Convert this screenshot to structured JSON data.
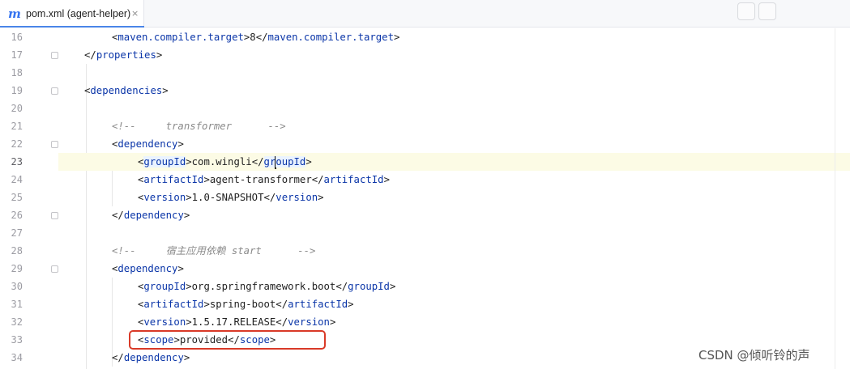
{
  "tab": {
    "title": "pom.xml (agent-helper)",
    "icon": "maven-icon",
    "close": "×"
  },
  "colors": {
    "tag": "#0a35a8",
    "comment": "#8b8b8b",
    "current_line": "#fcfbe5",
    "annotation_box": "#d93a28"
  },
  "lines": [
    {
      "num": "16",
      "parts": [
        {
          "t": "<",
          "c": "br"
        },
        {
          "t": "maven.compiler.target",
          "c": "tag"
        },
        {
          "t": ">",
          "c": "br"
        },
        {
          "t": "8",
          "c": "txt"
        },
        {
          "t": "</",
          "c": "br"
        },
        {
          "t": "maven.compiler.target",
          "c": "tag"
        },
        {
          "t": ">",
          "c": "br"
        }
      ]
    },
    {
      "num": "17",
      "parts": [
        {
          "t": "</",
          "c": "br"
        },
        {
          "t": "properties",
          "c": "tag"
        },
        {
          "t": ">",
          "c": "br"
        }
      ]
    },
    {
      "num": "18",
      "parts": []
    },
    {
      "num": "19",
      "parts": [
        {
          "t": "<",
          "c": "br"
        },
        {
          "t": "dependencies",
          "c": "tag"
        },
        {
          "t": ">",
          "c": "br"
        }
      ]
    },
    {
      "num": "20",
      "parts": []
    },
    {
      "num": "21",
      "parts": [
        {
          "t": "<!--     transformer      -->",
          "c": "cmt"
        }
      ]
    },
    {
      "num": "22",
      "parts": [
        {
          "t": "<",
          "c": "br"
        },
        {
          "t": "dependency",
          "c": "tag"
        },
        {
          "t": ">",
          "c": "br"
        }
      ]
    },
    {
      "num": "23",
      "parts": [
        {
          "t": "<",
          "c": "br"
        },
        {
          "t": "groupId",
          "c": "tag hl"
        },
        {
          "t": ">",
          "c": "br"
        },
        {
          "t": "com.wingli",
          "c": "txt"
        },
        {
          "t": "</",
          "c": "br"
        },
        {
          "t": "gr",
          "c": "tag hl"
        },
        {
          "t": "",
          "c": "caret"
        },
        {
          "t": "oupId",
          "c": "tag hl"
        },
        {
          "t": ">",
          "c": "br"
        }
      ]
    },
    {
      "num": "24",
      "parts": [
        {
          "t": "<",
          "c": "br"
        },
        {
          "t": "artifactId",
          "c": "tag"
        },
        {
          "t": ">",
          "c": "br"
        },
        {
          "t": "agent-transformer",
          "c": "txt"
        },
        {
          "t": "</",
          "c": "br"
        },
        {
          "t": "artifactId",
          "c": "tag"
        },
        {
          "t": ">",
          "c": "br"
        }
      ]
    },
    {
      "num": "25",
      "parts": [
        {
          "t": "<",
          "c": "br"
        },
        {
          "t": "version",
          "c": "tag"
        },
        {
          "t": ">",
          "c": "br"
        },
        {
          "t": "1.0-SNAPSHOT",
          "c": "txt"
        },
        {
          "t": "</",
          "c": "br"
        },
        {
          "t": "version",
          "c": "tag"
        },
        {
          "t": ">",
          "c": "br"
        }
      ]
    },
    {
      "num": "26",
      "parts": [
        {
          "t": "</",
          "c": "br"
        },
        {
          "t": "dependency",
          "c": "tag"
        },
        {
          "t": ">",
          "c": "br"
        }
      ]
    },
    {
      "num": "27",
      "parts": []
    },
    {
      "num": "28",
      "parts": [
        {
          "t": "<!--     宿主应用依赖 start      -->",
          "c": "cmt"
        }
      ]
    },
    {
      "num": "29",
      "parts": [
        {
          "t": "<",
          "c": "br"
        },
        {
          "t": "dependency",
          "c": "tag"
        },
        {
          "t": ">",
          "c": "br"
        }
      ]
    },
    {
      "num": "30",
      "parts": [
        {
          "t": "<",
          "c": "br"
        },
        {
          "t": "groupId",
          "c": "tag"
        },
        {
          "t": ">",
          "c": "br"
        },
        {
          "t": "org.springframework.boot",
          "c": "txt"
        },
        {
          "t": "</",
          "c": "br"
        },
        {
          "t": "groupId",
          "c": "tag"
        },
        {
          "t": ">",
          "c": "br"
        }
      ]
    },
    {
      "num": "31",
      "parts": [
        {
          "t": "<",
          "c": "br"
        },
        {
          "t": "artifactId",
          "c": "tag"
        },
        {
          "t": ">",
          "c": "br"
        },
        {
          "t": "spring-boot",
          "c": "txt"
        },
        {
          "t": "</",
          "c": "br"
        },
        {
          "t": "artifactId",
          "c": "tag"
        },
        {
          "t": ">",
          "c": "br"
        }
      ]
    },
    {
      "num": "32",
      "parts": [
        {
          "t": "<",
          "c": "br"
        },
        {
          "t": "version",
          "c": "tag"
        },
        {
          "t": ">",
          "c": "br"
        },
        {
          "t": "1.5.17.RELEASE",
          "c": "txt"
        },
        {
          "t": "</",
          "c": "br"
        },
        {
          "t": "version",
          "c": "tag"
        },
        {
          "t": ">",
          "c": "br"
        }
      ]
    },
    {
      "num": "33",
      "parts": [
        {
          "t": "<",
          "c": "br"
        },
        {
          "t": "scope",
          "c": "tag"
        },
        {
          "t": ">",
          "c": "br"
        },
        {
          "t": "provided",
          "c": "txt"
        },
        {
          "t": "</",
          "c": "br"
        },
        {
          "t": "scope",
          "c": "tag"
        },
        {
          "t": ">",
          "c": "br"
        }
      ]
    },
    {
      "num": "34",
      "parts": [
        {
          "t": "</",
          "c": "br"
        },
        {
          "t": "dependency",
          "c": "tag"
        },
        {
          "t": ">",
          "c": "br"
        }
      ]
    }
  ],
  "watermark": "CSDN @倾听铃的声"
}
